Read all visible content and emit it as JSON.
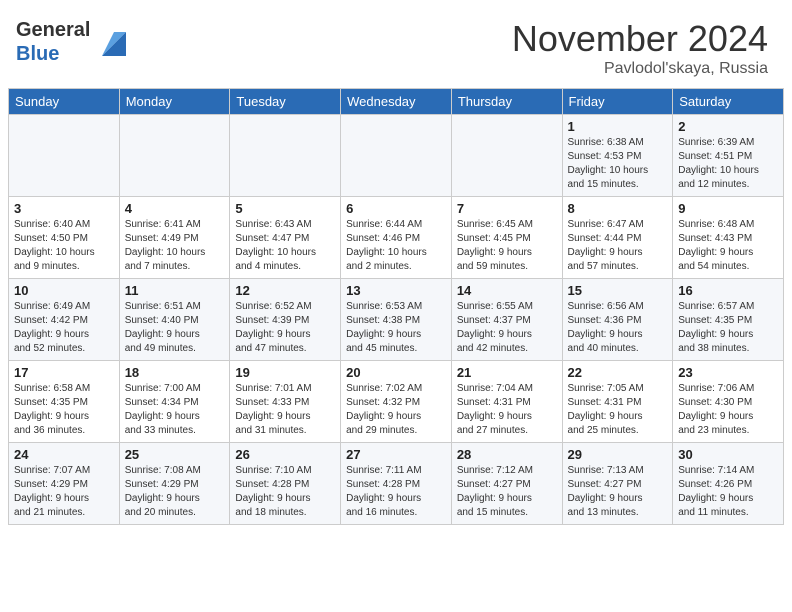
{
  "header": {
    "logo_general": "General",
    "logo_blue": "Blue",
    "month_title": "November 2024",
    "location": "Pavlodol'skaya, Russia"
  },
  "days_of_week": [
    "Sunday",
    "Monday",
    "Tuesday",
    "Wednesday",
    "Thursday",
    "Friday",
    "Saturday"
  ],
  "weeks": [
    {
      "days": [
        {
          "num": "",
          "info": ""
        },
        {
          "num": "",
          "info": ""
        },
        {
          "num": "",
          "info": ""
        },
        {
          "num": "",
          "info": ""
        },
        {
          "num": "",
          "info": ""
        },
        {
          "num": "1",
          "info": "Sunrise: 6:38 AM\nSunset: 4:53 PM\nDaylight: 10 hours\nand 15 minutes."
        },
        {
          "num": "2",
          "info": "Sunrise: 6:39 AM\nSunset: 4:51 PM\nDaylight: 10 hours\nand 12 minutes."
        }
      ]
    },
    {
      "days": [
        {
          "num": "3",
          "info": "Sunrise: 6:40 AM\nSunset: 4:50 PM\nDaylight: 10 hours\nand 9 minutes."
        },
        {
          "num": "4",
          "info": "Sunrise: 6:41 AM\nSunset: 4:49 PM\nDaylight: 10 hours\nand 7 minutes."
        },
        {
          "num": "5",
          "info": "Sunrise: 6:43 AM\nSunset: 4:47 PM\nDaylight: 10 hours\nand 4 minutes."
        },
        {
          "num": "6",
          "info": "Sunrise: 6:44 AM\nSunset: 4:46 PM\nDaylight: 10 hours\nand 2 minutes."
        },
        {
          "num": "7",
          "info": "Sunrise: 6:45 AM\nSunset: 4:45 PM\nDaylight: 9 hours\nand 59 minutes."
        },
        {
          "num": "8",
          "info": "Sunrise: 6:47 AM\nSunset: 4:44 PM\nDaylight: 9 hours\nand 57 minutes."
        },
        {
          "num": "9",
          "info": "Sunrise: 6:48 AM\nSunset: 4:43 PM\nDaylight: 9 hours\nand 54 minutes."
        }
      ]
    },
    {
      "days": [
        {
          "num": "10",
          "info": "Sunrise: 6:49 AM\nSunset: 4:42 PM\nDaylight: 9 hours\nand 52 minutes."
        },
        {
          "num": "11",
          "info": "Sunrise: 6:51 AM\nSunset: 4:40 PM\nDaylight: 9 hours\nand 49 minutes."
        },
        {
          "num": "12",
          "info": "Sunrise: 6:52 AM\nSunset: 4:39 PM\nDaylight: 9 hours\nand 47 minutes."
        },
        {
          "num": "13",
          "info": "Sunrise: 6:53 AM\nSunset: 4:38 PM\nDaylight: 9 hours\nand 45 minutes."
        },
        {
          "num": "14",
          "info": "Sunrise: 6:55 AM\nSunset: 4:37 PM\nDaylight: 9 hours\nand 42 minutes."
        },
        {
          "num": "15",
          "info": "Sunrise: 6:56 AM\nSunset: 4:36 PM\nDaylight: 9 hours\nand 40 minutes."
        },
        {
          "num": "16",
          "info": "Sunrise: 6:57 AM\nSunset: 4:35 PM\nDaylight: 9 hours\nand 38 minutes."
        }
      ]
    },
    {
      "days": [
        {
          "num": "17",
          "info": "Sunrise: 6:58 AM\nSunset: 4:35 PM\nDaylight: 9 hours\nand 36 minutes."
        },
        {
          "num": "18",
          "info": "Sunrise: 7:00 AM\nSunset: 4:34 PM\nDaylight: 9 hours\nand 33 minutes."
        },
        {
          "num": "19",
          "info": "Sunrise: 7:01 AM\nSunset: 4:33 PM\nDaylight: 9 hours\nand 31 minutes."
        },
        {
          "num": "20",
          "info": "Sunrise: 7:02 AM\nSunset: 4:32 PM\nDaylight: 9 hours\nand 29 minutes."
        },
        {
          "num": "21",
          "info": "Sunrise: 7:04 AM\nSunset: 4:31 PM\nDaylight: 9 hours\nand 27 minutes."
        },
        {
          "num": "22",
          "info": "Sunrise: 7:05 AM\nSunset: 4:31 PM\nDaylight: 9 hours\nand 25 minutes."
        },
        {
          "num": "23",
          "info": "Sunrise: 7:06 AM\nSunset: 4:30 PM\nDaylight: 9 hours\nand 23 minutes."
        }
      ]
    },
    {
      "days": [
        {
          "num": "24",
          "info": "Sunrise: 7:07 AM\nSunset: 4:29 PM\nDaylight: 9 hours\nand 21 minutes."
        },
        {
          "num": "25",
          "info": "Sunrise: 7:08 AM\nSunset: 4:29 PM\nDaylight: 9 hours\nand 20 minutes."
        },
        {
          "num": "26",
          "info": "Sunrise: 7:10 AM\nSunset: 4:28 PM\nDaylight: 9 hours\nand 18 minutes."
        },
        {
          "num": "27",
          "info": "Sunrise: 7:11 AM\nSunset: 4:28 PM\nDaylight: 9 hours\nand 16 minutes."
        },
        {
          "num": "28",
          "info": "Sunrise: 7:12 AM\nSunset: 4:27 PM\nDaylight: 9 hours\nand 15 minutes."
        },
        {
          "num": "29",
          "info": "Sunrise: 7:13 AM\nSunset: 4:27 PM\nDaylight: 9 hours\nand 13 minutes."
        },
        {
          "num": "30",
          "info": "Sunrise: 7:14 AM\nSunset: 4:26 PM\nDaylight: 9 hours\nand 11 minutes."
        }
      ]
    }
  ]
}
